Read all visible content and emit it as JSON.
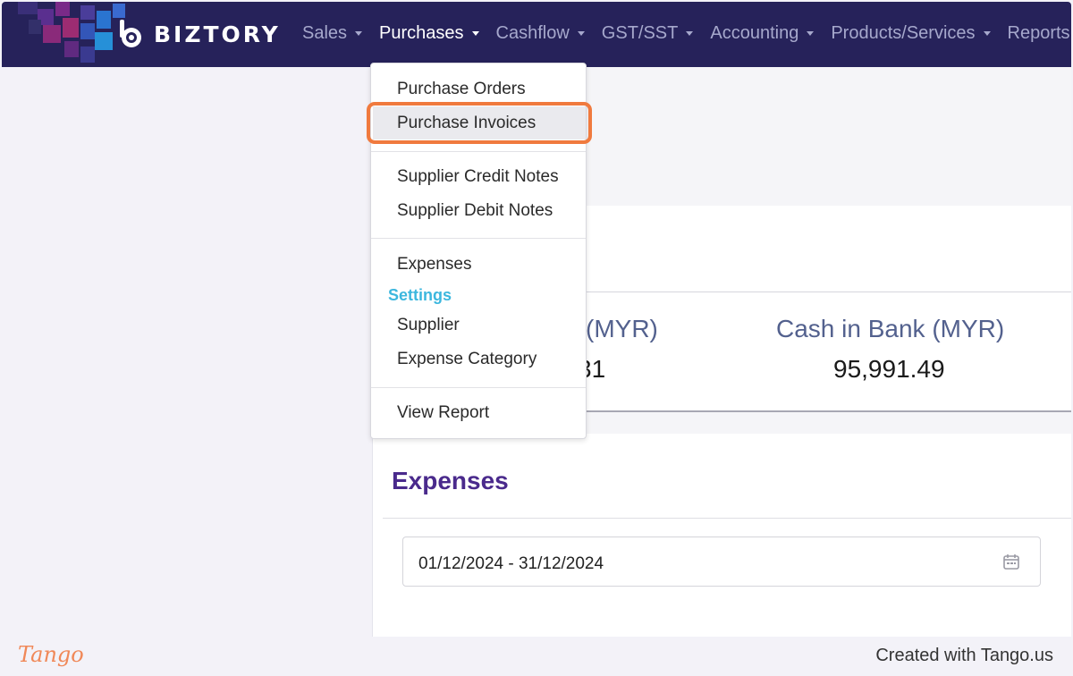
{
  "brand": {
    "name": "BIZTORY"
  },
  "nav": {
    "items": [
      {
        "label": "Sales",
        "caret": true
      },
      {
        "label": "Purchases",
        "caret": true,
        "active": true
      },
      {
        "label": "Cashflow",
        "caret": true
      },
      {
        "label": "GST/SST",
        "caret": true
      },
      {
        "label": "Accounting",
        "caret": true
      },
      {
        "label": "Products/Services",
        "caret": true
      },
      {
        "label": "Reports",
        "caret": false
      }
    ]
  },
  "dropdown": {
    "purchase_orders": "Purchase Orders",
    "purchase_invoices": "Purchase Invoices",
    "supplier_credit_notes": "Supplier Credit Notes",
    "supplier_debit_notes": "Supplier Debit Notes",
    "expenses": "Expenses",
    "settings_header": "Settings",
    "supplier": "Supplier",
    "expense_category": "Expense Category",
    "view_report": "View Report",
    "highlighted": "Purchase Invoices"
  },
  "stats": {
    "partial_label": "l (MYR)",
    "partial_value": "31",
    "cash_label": "Cash in Bank (MYR)",
    "cash_value": "95,991.49"
  },
  "expenses": {
    "title": "Expenses",
    "date_range": "01/12/2024 - 31/12/2024",
    "calendar_icon": "calendar-icon"
  },
  "footer": {
    "logo": "Tango",
    "credit": "Created with Tango.us"
  },
  "colors": {
    "navbar": "#26225a",
    "nav_text": "#a6a8cc",
    "nav_active": "#ffffff",
    "highlight_ring": "#f07a3e",
    "settings_header": "#3cb7de",
    "expenses_title": "#4a2a8c",
    "stat_label": "#53618e",
    "tango": "#f08858"
  }
}
